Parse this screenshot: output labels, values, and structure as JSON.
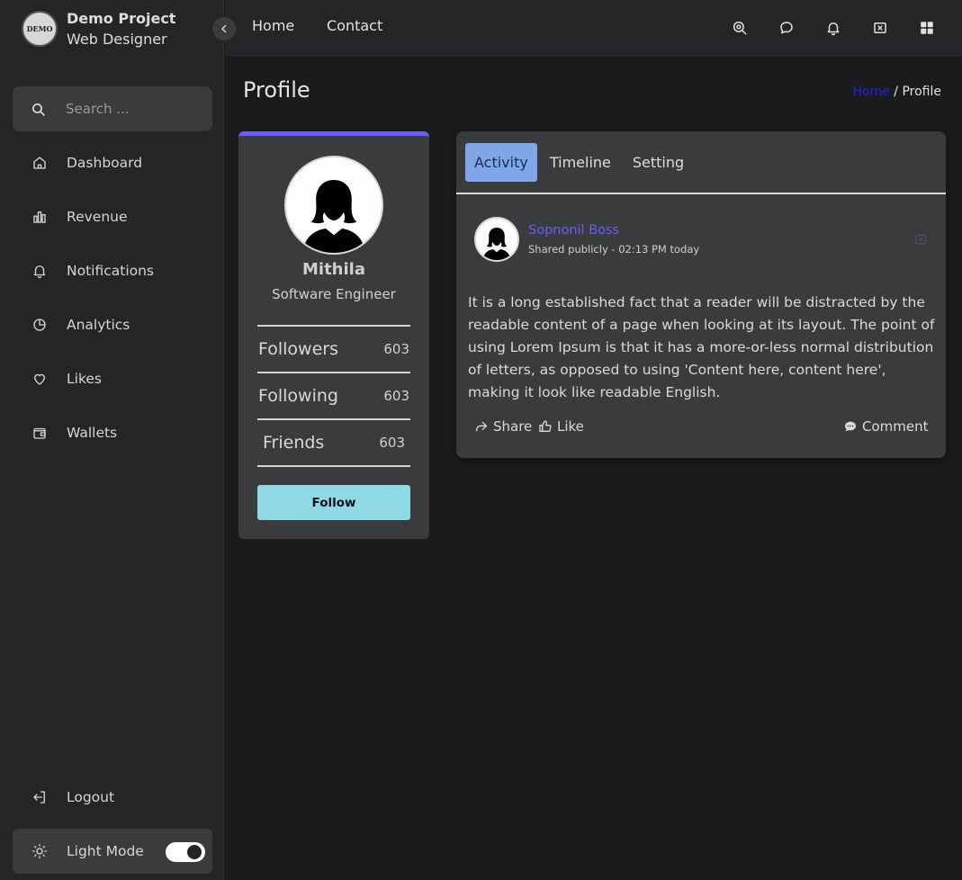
{
  "brand": {
    "logo_text": "DEMO",
    "name": "Demo Project",
    "role": "Web Designer"
  },
  "search": {
    "placeholder": "Search ..."
  },
  "sidebar": {
    "items": [
      {
        "label": "Dashboard",
        "icon": "home-icon"
      },
      {
        "label": "Revenue",
        "icon": "bar-chart-icon"
      },
      {
        "label": "Notifications",
        "icon": "bell-icon"
      },
      {
        "label": "Analytics",
        "icon": "pie-chart-icon"
      },
      {
        "label": "Likes",
        "icon": "heart-icon"
      },
      {
        "label": "Wallets",
        "icon": "wallet-icon"
      }
    ],
    "logout": "Logout",
    "light_mode": "Light Mode"
  },
  "topnav": {
    "links": [
      "Home",
      "Contact"
    ],
    "icons": [
      "search-icon",
      "chat-icon",
      "bell-icon",
      "close-box-icon",
      "grid-icon"
    ]
  },
  "page": {
    "title": "Profile",
    "breadcrumb_home": "Home",
    "breadcrumb_sep": " / ",
    "breadcrumb_current": "Profile"
  },
  "profile": {
    "name": "Mithila",
    "role": "Software Engineer",
    "stats": [
      {
        "label": "Followers",
        "value": "603"
      },
      {
        "label": "Following",
        "value": "603"
      },
      {
        "label": "Friends",
        "value": "603"
      }
    ],
    "follow_label": "Follow",
    "accent": "#6a5cff"
  },
  "activity": {
    "tabs": [
      "Activity",
      "Timeline",
      "Setting"
    ],
    "active_tab": "Activity",
    "post": {
      "author": "Sopnonil Boss",
      "meta": "Shared publicly - 02:13 PM today",
      "text": "It is a long established fact that a reader will be distracted by the readable content of a page when looking at its layout. The point of using Lorem Ipsum is that it has a more-or-less normal distribution of letters, as opposed to using 'Content here, content here', making it look like readable English.",
      "share": "Share",
      "like": "Like",
      "comment": "Comment"
    }
  },
  "colors": {
    "background": "#1b1b1d",
    "panel": "#242526",
    "card": "#3a3b3c",
    "accent": "#6a5cff",
    "tab_active": "#7ea6e8",
    "follow_button": "#8fd8e6",
    "link": "#2323e6"
  }
}
